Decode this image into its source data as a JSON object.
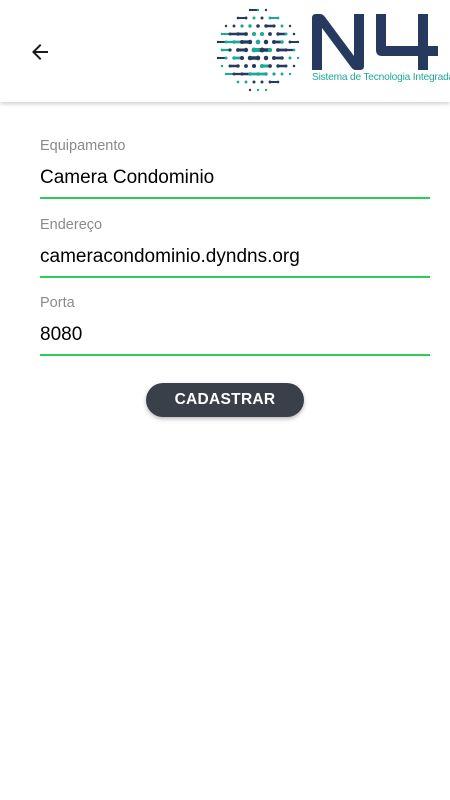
{
  "header": {
    "back_icon": "arrow-left-icon",
    "logo": {
      "text": "N4",
      "tagline": "Sistema de Tecnologia Integrada",
      "colors": {
        "navy": "#253a5e",
        "teal": "#1ea896"
      }
    }
  },
  "form": {
    "fields": [
      {
        "label": "Equipamento",
        "value": "Camera Condominio"
      },
      {
        "label": "Endereço",
        "value": "cameracondominio.dyndns.org"
      },
      {
        "label": "Porta",
        "value": "8080"
      }
    ],
    "submit_label": "CADASTRAR"
  },
  "colors": {
    "accent_underline": "#2ecc58",
    "button_bg": "#3a404a",
    "label_text": "#8a8a8a"
  }
}
